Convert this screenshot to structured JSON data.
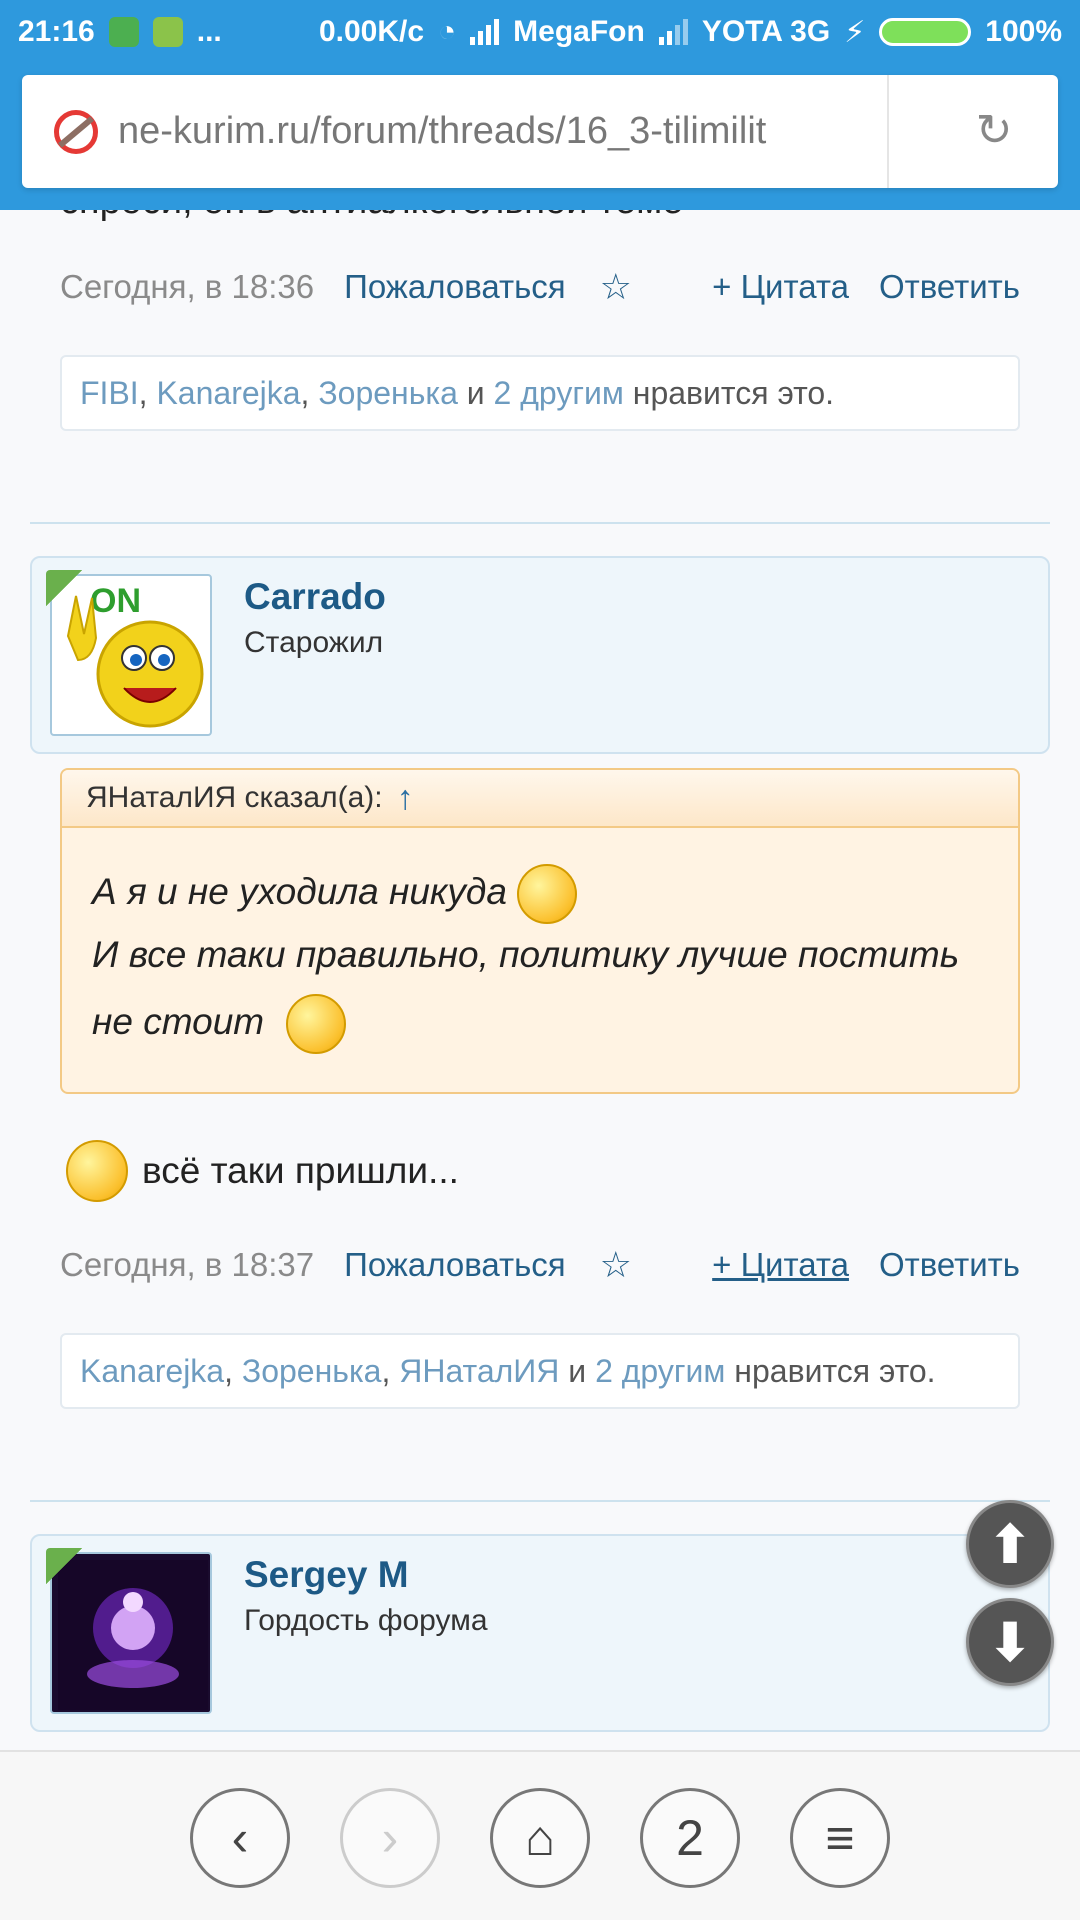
{
  "status": {
    "time": "21:16",
    "dots": "...",
    "speed": "0.00K/c",
    "carrier1": "MegaFon",
    "carrier2": "YOTA 3G",
    "battery": "100%"
  },
  "browser": {
    "url": "ne-kurim.ru/forum/threads/16_3-tilimilit",
    "reload_icon": "reload-icon"
  },
  "posts": [
    {
      "clipped_text": "спроси, он в антиалкогольной теме",
      "date": "Сегодня, в 18:36",
      "report": "Пожаловаться",
      "star": "☆",
      "quote_btn": "+ Цитата",
      "reply_btn": "Ответить",
      "likes": {
        "users": [
          "FIBI",
          "Kanarejka",
          "Зоренька"
        ],
        "and": "и",
        "others": "2 другим",
        "suffix": "нравится это."
      }
    },
    {
      "author": "Carrado",
      "rank": "Старожил",
      "quote": {
        "who": "ЯНаталИЯ сказал(а):",
        "arrow": "↑",
        "line1": "А я и не уходила никуда",
        "line2": "И все таки правильно, политику лучше постить",
        "line3": "не стоит"
      },
      "text": "всё таки пришли...",
      "date": "Сегодня, в 18:37",
      "report": "Пожаловаться",
      "star": "☆",
      "quote_btn": "+ Цитата",
      "reply_btn": "Ответить",
      "likes": {
        "users": [
          "Kanarejka",
          "Зоренька",
          "ЯНаталИЯ"
        ],
        "and": "и",
        "others": "2 другим",
        "suffix": "нравится это."
      }
    },
    {
      "author": "Sergey M",
      "rank": "Гордость форума"
    }
  ],
  "toolbar": {
    "back": "‹",
    "forward": "›",
    "home": "⌂",
    "tabs": "2",
    "menu": "≡"
  }
}
